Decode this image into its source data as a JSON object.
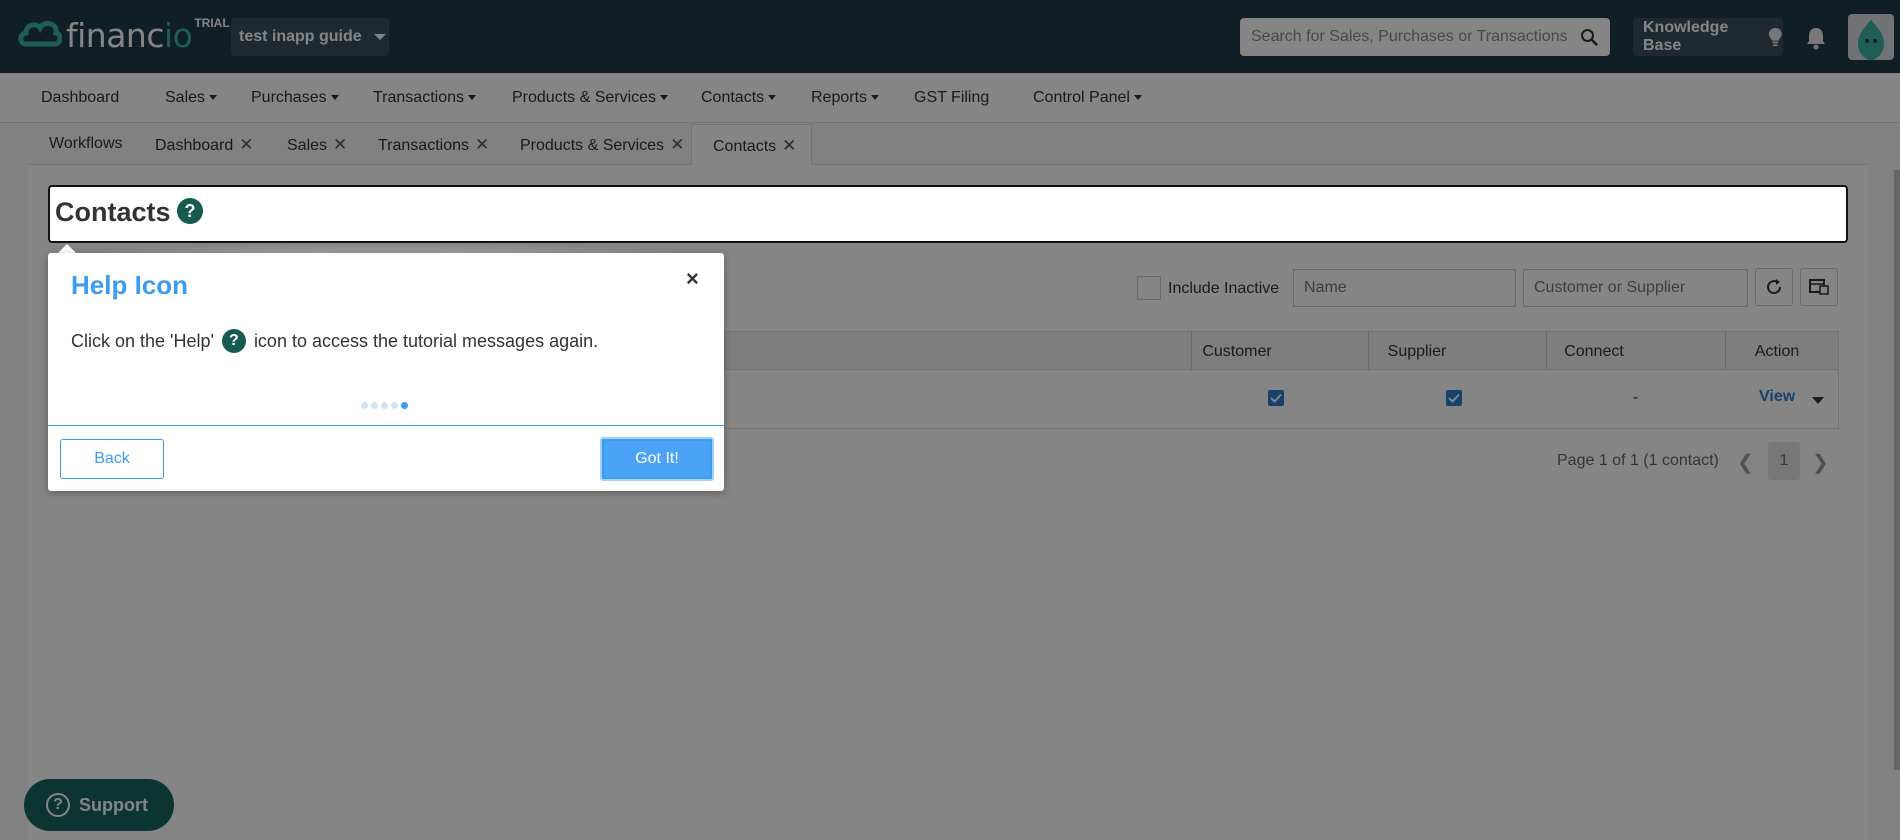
{
  "topbar": {
    "logo_text": "financ",
    "logo_text_io": "io",
    "trial_badge": "TRIAL",
    "org_name": "test inapp guide",
    "search_placeholder": "Search for Sales, Purchases or Transactions",
    "knowledge_base": "Knowledge Base",
    "colors": {
      "background": "#1f3b4a",
      "brand_teal": "#3bb5a6"
    }
  },
  "nav": {
    "items": [
      {
        "label": "Dashboard",
        "dropdown": false
      },
      {
        "label": "Sales",
        "dropdown": true
      },
      {
        "label": "Purchases",
        "dropdown": true
      },
      {
        "label": "Transactions",
        "dropdown": true
      },
      {
        "label": "Products & Services",
        "dropdown": true
      },
      {
        "label": "Contacts",
        "dropdown": true
      },
      {
        "label": "Reports",
        "dropdown": true
      },
      {
        "label": "GST Filing",
        "dropdown": false
      },
      {
        "label": "Control Panel",
        "dropdown": true
      }
    ]
  },
  "tabs": [
    {
      "label": "Workflows",
      "closable": false
    },
    {
      "label": "Dashboard",
      "closable": true
    },
    {
      "label": "Sales",
      "closable": true
    },
    {
      "label": "Transactions",
      "closable": true
    },
    {
      "label": "Products & Services",
      "closable": true
    },
    {
      "label": "Contacts",
      "closable": true,
      "active": true
    }
  ],
  "page": {
    "title": "Contacts",
    "help_glyph": "?"
  },
  "filters": {
    "include_inactive_label": "Include Inactive",
    "include_inactive_checked": false,
    "name_placeholder": "Name",
    "type_placeholder": "Customer or Supplier"
  },
  "table": {
    "columns": [
      "Customer",
      "Supplier",
      "Connect",
      "Action"
    ],
    "rows": [
      {
        "customer": true,
        "supplier": true,
        "connect": "-",
        "action": "View"
      }
    ]
  },
  "pager": {
    "summary": "Page 1 of 1 (1 contact)",
    "current_page": "1"
  },
  "support": {
    "label": "Support",
    "glyph": "?"
  },
  "tour": {
    "title": "Help Icon",
    "close_glyph": "×",
    "body_before": "Click on the 'Help'",
    "body_icon": "?",
    "body_after": "icon to access the tutorial messages again.",
    "step_current": 5,
    "step_total": 5,
    "back_label": "Back",
    "done_label": "Got It!",
    "accent_color": "#3b9cf0"
  }
}
